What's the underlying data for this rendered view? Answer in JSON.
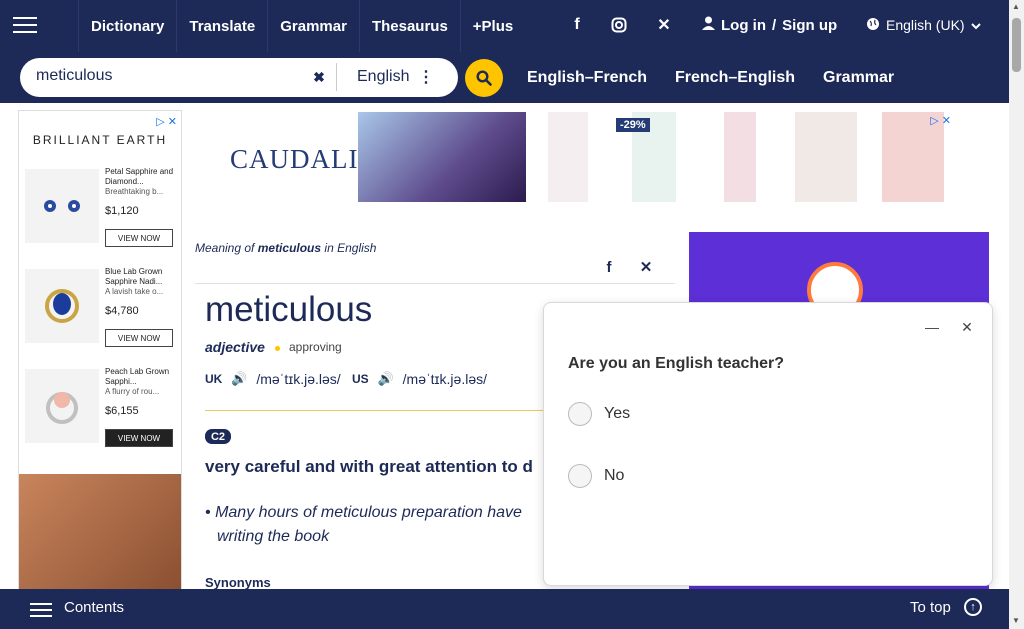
{
  "nav": {
    "links": [
      "Dictionary",
      "Translate",
      "Grammar",
      "Thesaurus",
      "+Plus"
    ],
    "login": "Log in",
    "signup": "Sign up",
    "language": "English (UK)"
  },
  "search": {
    "query": "meticulous",
    "dictionary": "English",
    "quick_links": [
      "English–French",
      "French–English",
      "Grammar"
    ]
  },
  "left_ad": {
    "brand": "BRILLIANT EARTH",
    "products": [
      {
        "title": "Petal Sapphire and Diamond...",
        "subtitle": "Breathtaking b...",
        "price": "$1,120",
        "cta": "VIEW NOW"
      },
      {
        "title": "Blue Lab Grown Sapphire Nadi...",
        "subtitle": "A lavish take o...",
        "price": "$4,780",
        "cta": "VIEW NOW"
      },
      {
        "title": "Peach Lab Grown Sapphi...",
        "subtitle": "A flurry of rou...",
        "price": "$6,155",
        "cta": "VIEW NOW"
      }
    ]
  },
  "banner_ad": {
    "brand": "CAUDALIE",
    "discount": "-29%"
  },
  "entry": {
    "breadcrumb_prefix": "Meaning of",
    "breadcrumb_word": "meticulous",
    "breadcrumb_suffix": "in English",
    "headword": "meticulous",
    "pos": "adjective",
    "usage": "approving",
    "uk_label": "UK",
    "us_label": "US",
    "uk_ipa": "/məˈtɪk.jə.ləs/",
    "us_ipa": "/məˈtɪk.jə.ləs/",
    "level": "C2",
    "definition": [
      "very",
      "careful",
      "and with",
      "great",
      "attention",
      "to d"
    ],
    "example_line1": [
      "Many",
      "hours",
      "of meticulous",
      "preparation",
      "have"
    ],
    "example_line2": [
      "writing the",
      "book"
    ],
    "synonyms_label": "Synonyms"
  },
  "survey": {
    "question": "Are you an English teacher?",
    "options": [
      "Yes",
      "No"
    ]
  },
  "bottom": {
    "contents": "Contents",
    "to_top": "To top"
  },
  "colors": {
    "navy": "#1d2a57",
    "yellow": "#fec400",
    "purple": "#5d2fd6"
  }
}
